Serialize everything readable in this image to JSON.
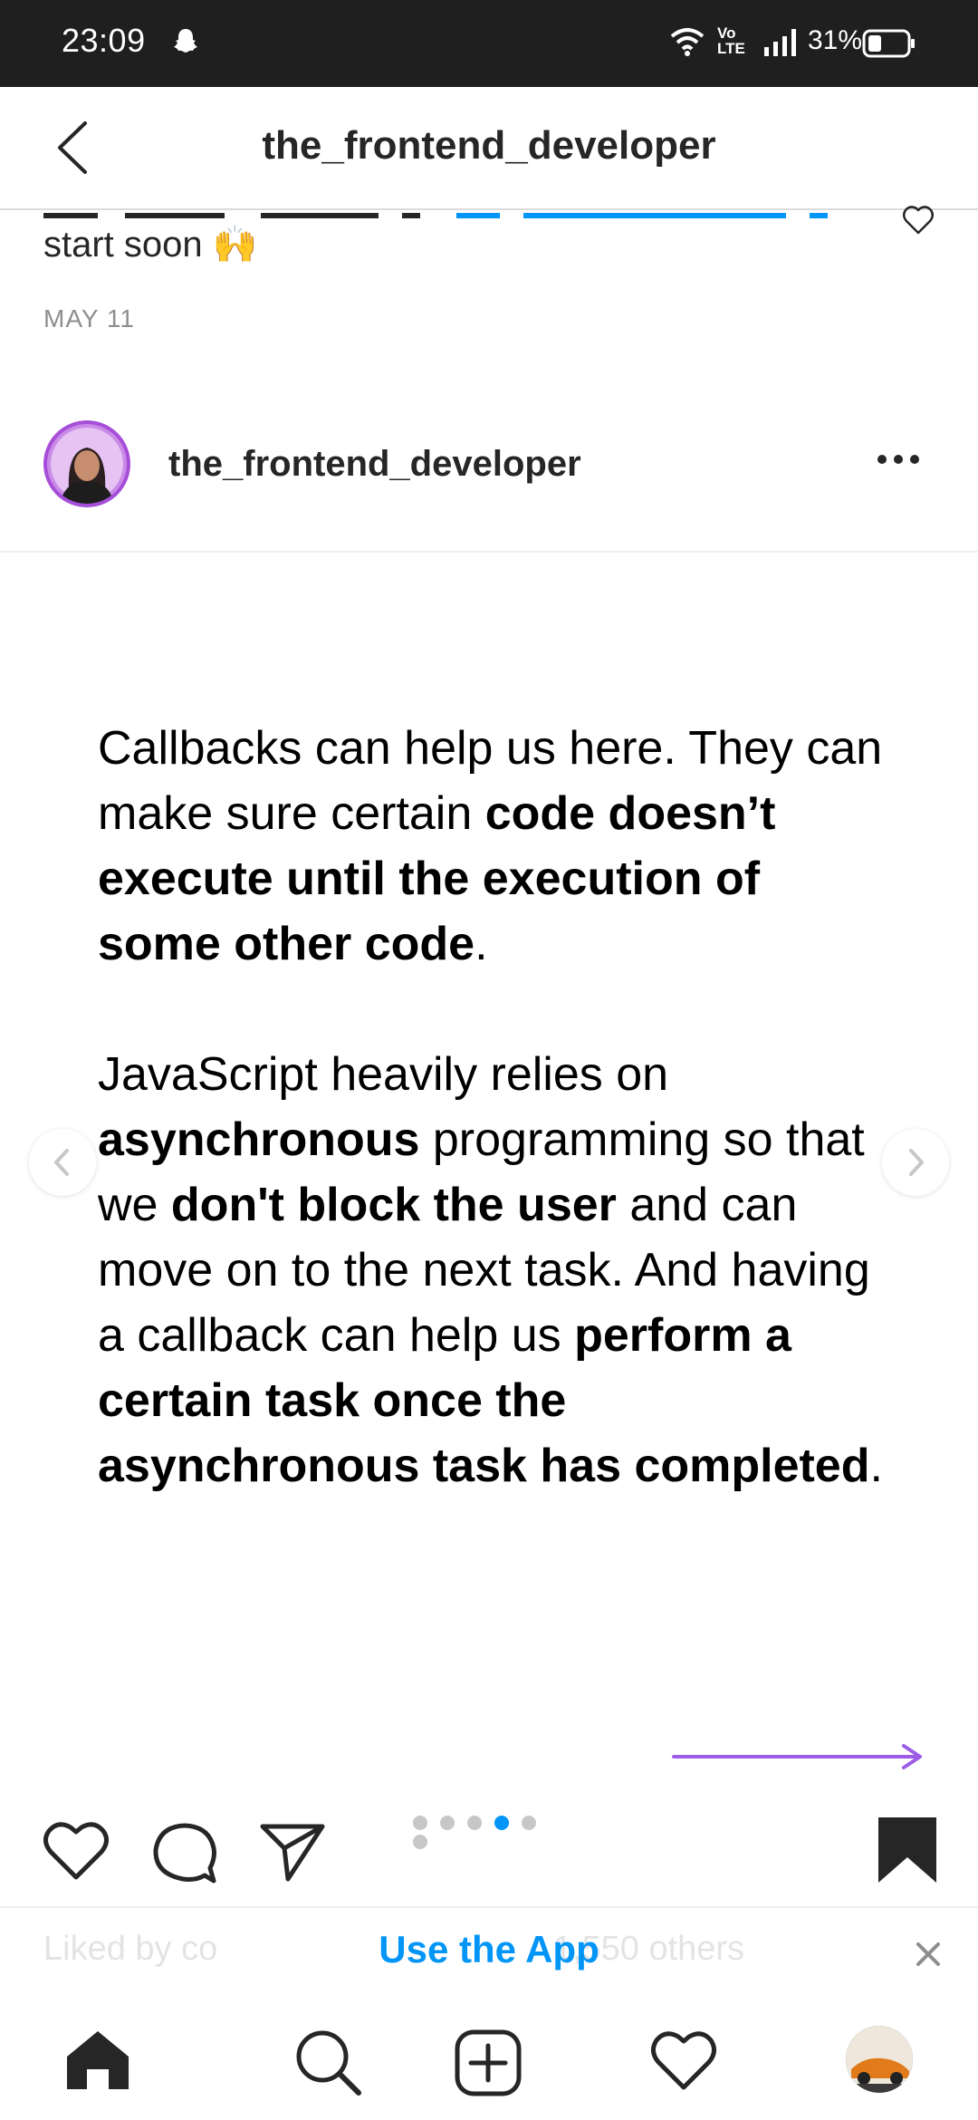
{
  "status_bar": {
    "time": "23:09",
    "volte_top": "Vo",
    "volte_bottom": "LTE",
    "battery_percent": "31%"
  },
  "header": {
    "title": "the_frontend_developer"
  },
  "previous_post": {
    "caption_tail": "start soon 🙌",
    "date": "MAY 11"
  },
  "post": {
    "username": "the_frontend_developer",
    "content": {
      "p1_a": "Callbacks can help us here. They can make sure certain ",
      "p1_b": "code doesn’t execute until the execution of some other code",
      "p1_c": ".",
      "p2_a": "JavaScript heavily relies on ",
      "p2_b": "asynchronous",
      "p2_c": " programming so that we ",
      "p2_d": "don't block the user",
      "p2_e": " and can move on to the next task. And having a callback can help us ",
      "p2_f": "perform a certain task once the asynchronous task has completed",
      "p2_g": "."
    },
    "carousel": {
      "total": 6,
      "active_index": 3
    }
  },
  "app_banner": {
    "liked_by_faded": "Liked by co",
    "others_faded": "1,550 others",
    "cta": "Use the App"
  },
  "icons": {
    "back": "back-arrow-icon",
    "heart": "heart-icon",
    "comment": "comment-icon",
    "share": "share-icon",
    "save": "bookmark-icon",
    "home": "home-icon",
    "search": "search-icon",
    "add": "add-post-icon",
    "activity": "activity-heart-icon"
  },
  "colors": {
    "status_bar": "#1f1f1f",
    "link_blue": "#0095f6",
    "avatar_ring": "#a64ed8",
    "arrow_purple": "#9b5de5"
  }
}
